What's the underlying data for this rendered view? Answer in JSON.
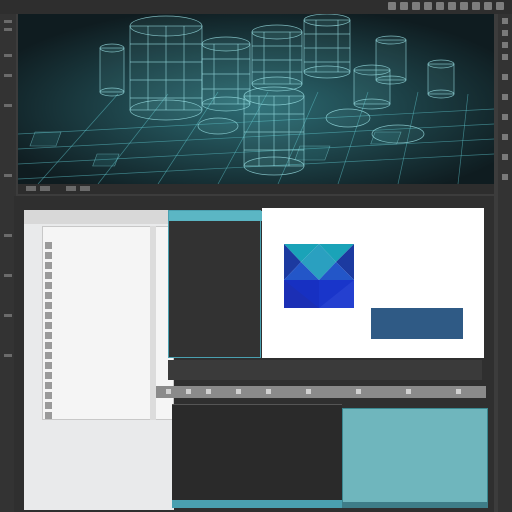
{
  "viewport": {
    "scene": "wireframe-cylinders"
  },
  "left_panel": {
    "title": "",
    "items": [
      {
        "label": "",
        "icon": "layer-icon"
      },
      {
        "label": "",
        "icon": "layer-icon"
      },
      {
        "label": "",
        "icon": "layer-icon"
      },
      {
        "label": "",
        "icon": "layer-icon"
      },
      {
        "label": "",
        "icon": "layer-icon"
      },
      {
        "label": "",
        "icon": "layer-icon"
      },
      {
        "label": "",
        "icon": "layer-icon"
      },
      {
        "label": "",
        "icon": "layer-icon"
      },
      {
        "label": "",
        "icon": "layer-icon"
      },
      {
        "label": "",
        "icon": "layer-icon"
      },
      {
        "label": "",
        "icon": "layer-icon"
      },
      {
        "label": "",
        "icon": "layer-icon"
      },
      {
        "label": "",
        "icon": "layer-icon"
      },
      {
        "label": "",
        "icon": "layer-icon"
      },
      {
        "label": "",
        "icon": "layer-icon"
      },
      {
        "label": "",
        "icon": "layer-icon"
      },
      {
        "label": "",
        "icon": "layer-icon"
      },
      {
        "label": "",
        "icon": "layer-icon"
      },
      {
        "label": "",
        "icon": "layer-icon"
      },
      {
        "label": "",
        "icon": "layer-icon"
      }
    ]
  },
  "code_panel": {
    "tab_label": "",
    "lines": [
      "",
      "",
      "",
      "",
      "",
      "",
      "",
      "",
      "",
      ""
    ]
  },
  "preview": {
    "labels": [
      "",
      "",
      "",
      "",
      ""
    ]
  },
  "lower_toolbar": {
    "text": ""
  },
  "terminal": {
    "lines": [
      "",
      "",
      ""
    ]
  },
  "colors": {
    "accent": "#5bb6c4",
    "viewport_bg": "#1a2a2f",
    "wire": "#7fd3d8",
    "preview_blue": "#2f5a85"
  }
}
